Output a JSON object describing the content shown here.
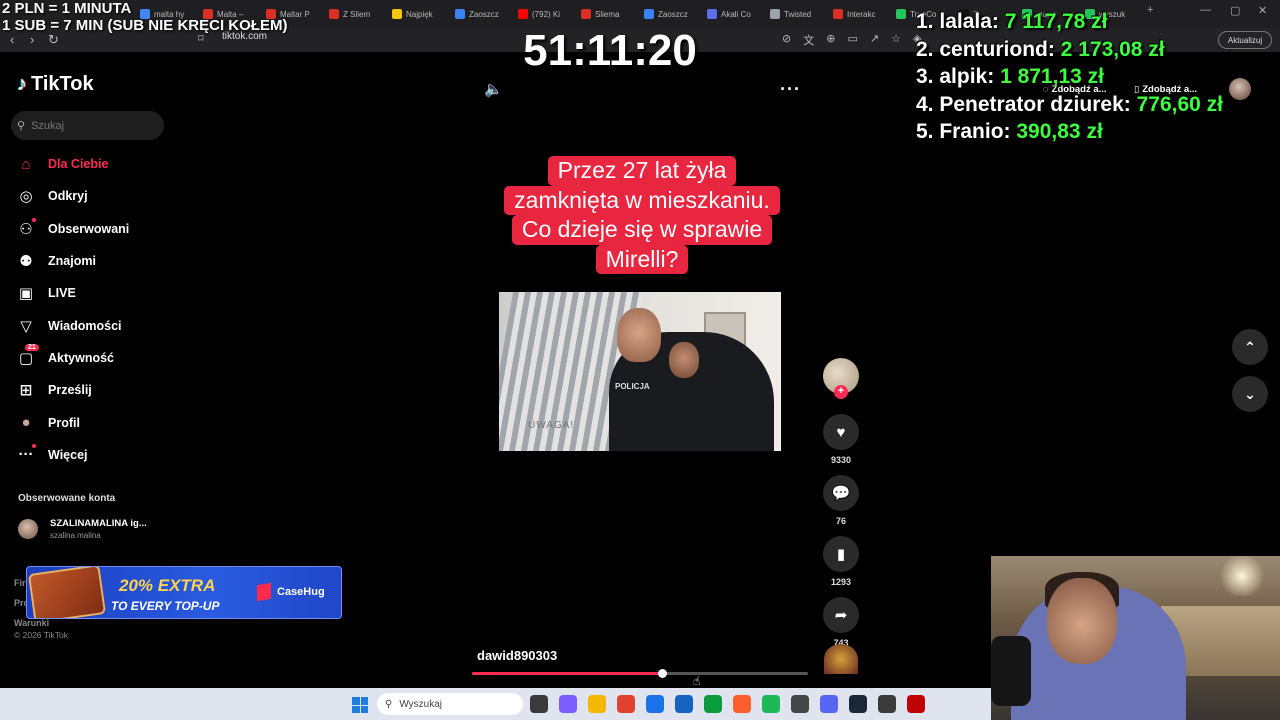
{
  "overlay": {
    "pln_rule": "2 PLN =  1 MINUTA",
    "sub_rule": "1 SUB = 7 MIN (SUB NIE KRĘCI KOŁEM)",
    "timer": "51:11:20",
    "donors": [
      {
        "rank": "1.",
        "name": "lalala:",
        "amount": "7 117,78 zł"
      },
      {
        "rank": "2.",
        "name": "centuriond:",
        "amount": "2 173,08 zł"
      },
      {
        "rank": "3.",
        "name": "alpik:",
        "amount": "1 871,13 zł"
      },
      {
        "rank": "4.",
        "name": "Penetrator dziurek:",
        "amount": "776,60 zł"
      },
      {
        "rank": "5.",
        "name": "Franio:",
        "amount": "390,83 zł"
      }
    ]
  },
  "browser": {
    "tabs": [
      {
        "label": "malta hy",
        "color": "#4285f4"
      },
      {
        "label": "Malta –",
        "color": "#d93025"
      },
      {
        "label": "Maltar P",
        "color": "#d93025"
      },
      {
        "label": "Z Sliem",
        "color": "#d93025"
      },
      {
        "label": "Najpięk",
        "color": "#f7c600"
      },
      {
        "label": "Zaoszcz",
        "color": "#3b82f6"
      },
      {
        "label": "(792) Ki",
        "color": "#ff0000"
      },
      {
        "label": "Sliema",
        "color": "#d93025"
      },
      {
        "label": "Zaoszcz",
        "color": "#3b82f6"
      },
      {
        "label": "Akali Co",
        "color": "#5b6df0"
      },
      {
        "label": "Twisted",
        "color": "#9ca3af"
      },
      {
        "label": "Interakc",
        "color": "#d93025"
      },
      {
        "label": "TrueCo",
        "color": "#22c55e"
      },
      {
        "label": "T",
        "color": "#111111"
      },
      {
        "label": "mapa",
        "color": "#22c55e"
      },
      {
        "label": "wyszuk",
        "color": "#22c55e"
      }
    ],
    "url": "tiktok.com",
    "update_label": "Aktualizuj"
  },
  "tiktok": {
    "logo": "TikTok",
    "search_placeholder": "Szukaj",
    "nav": [
      {
        "label": "Dla Ciebie",
        "icon": "home-icon"
      },
      {
        "label": "Odkryj",
        "icon": "compass-icon"
      },
      {
        "label": "Obserwowani",
        "icon": "following-icon"
      },
      {
        "label": "Znajomi",
        "icon": "friends-icon"
      },
      {
        "label": "LIVE",
        "icon": "live-icon"
      },
      {
        "label": "Wiadomości",
        "icon": "messages-icon"
      },
      {
        "label": "Aktywność",
        "icon": "activity-icon",
        "badge": "21"
      },
      {
        "label": "Prześlij",
        "icon": "upload-icon"
      },
      {
        "label": "Profil",
        "icon": "profile-icon"
      },
      {
        "label": "Więcej",
        "icon": "more-icon"
      }
    ],
    "followed_heading": "Obserwowane konta",
    "followed_account": {
      "name": "SZALINAMALINA ig...",
      "handle": "szalina.malina"
    },
    "footer_links": [
      "Firma",
      "Pro",
      "Warunki"
    ],
    "copyright": "© 2026 TikTok",
    "get_app_labels": [
      "Zdobądź a...",
      "Zdobądź a..."
    ]
  },
  "ad": {
    "headline_highlight": "20% EXTRA",
    "subline": "TO EVERY TOP-UP",
    "brand": "CaseHug"
  },
  "video": {
    "caption_lines": [
      "Przez 27 lat żyła",
      "zamknięta w mieszkaniu.",
      "Co dzieje się w sprawie",
      "Mirelli?"
    ],
    "inset_label": "POLICJA",
    "author": "dawid890303",
    "progress": 0.565,
    "likes": "9330",
    "comments": "76",
    "bookmarks": "1293",
    "shares": "743"
  },
  "taskbar": {
    "search_placeholder": "Wyszukaj",
    "apps": [
      "#3a3a3a",
      "#7b5cff",
      "#f5b800",
      "#e0422d",
      "#1a73e8",
      "#1565c0",
      "#0a9b3a",
      "#ff5d2c",
      "#1db954",
      "#444444",
      "#5865f2",
      "#1b2838",
      "#3a3a3a",
      "#c00000"
    ]
  }
}
